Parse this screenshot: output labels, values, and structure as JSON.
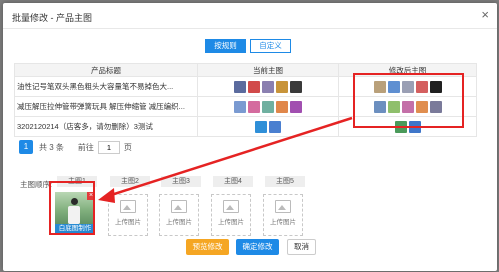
{
  "dialog": {
    "title": "批量修改 - 产品主图",
    "close_glyph": "×"
  },
  "tabs": {
    "by_rule": "按规则",
    "custom": "自定义"
  },
  "table": {
    "headers": [
      "产品标题",
      "当前主图",
      "修改后主图"
    ],
    "rows": [
      {
        "title": "油性记号笔双头黑色粗头大容量笔不易掉色大...",
        "current": [
          "#5b6b9e",
          "#d14a4a",
          "#8a7fb0",
          "#c8943a",
          "#3a3a3a"
        ],
        "after": [
          "#b9a07a",
          "#5f8fd1",
          "#9a9fb4",
          "#d45f5f",
          "#202020"
        ]
      },
      {
        "title": "减压解压拉伸管带弹簧玩具 解压伸缩管 减压编织...",
        "current": [
          "#7a9ad1",
          "#d46b9e",
          "#6fb0a0",
          "#e0874a",
          "#a14fb0"
        ],
        "after": [
          "#6c8fbf",
          "#8fbf6c",
          "#c46fa8",
          "#e08e4f",
          "#7a7a9a"
        ]
      },
      {
        "title": "3202120214（店客多，请勿删除）3测试",
        "current": [
          "#2f8fd8",
          "#4a7fd0"
        ],
        "after": [
          "#4a9a5a",
          "#3f76c9"
        ]
      }
    ]
  },
  "pager": {
    "current_page": "1",
    "total_label": "共 3 条",
    "goto_prefix": "前往",
    "page_input_value": "1",
    "page_suffix": "页"
  },
  "order": {
    "label": "主图顺序:",
    "slots": [
      {
        "tab": "主图1",
        "made_label": "白底图制作"
      },
      {
        "tab": "主图2",
        "upload_label": "上传图片"
      },
      {
        "tab": "主图3",
        "upload_label": "上传图片"
      },
      {
        "tab": "主图4",
        "upload_label": "上传图片"
      },
      {
        "tab": "主图5",
        "upload_label": "上传图片"
      }
    ]
  },
  "buttons": {
    "preview": "预览修改",
    "confirm": "确定修改",
    "cancel": "取消"
  },
  "colors": {
    "primary": "#1e8ae6",
    "warning": "#f5a623",
    "highlight": "#e52323"
  }
}
